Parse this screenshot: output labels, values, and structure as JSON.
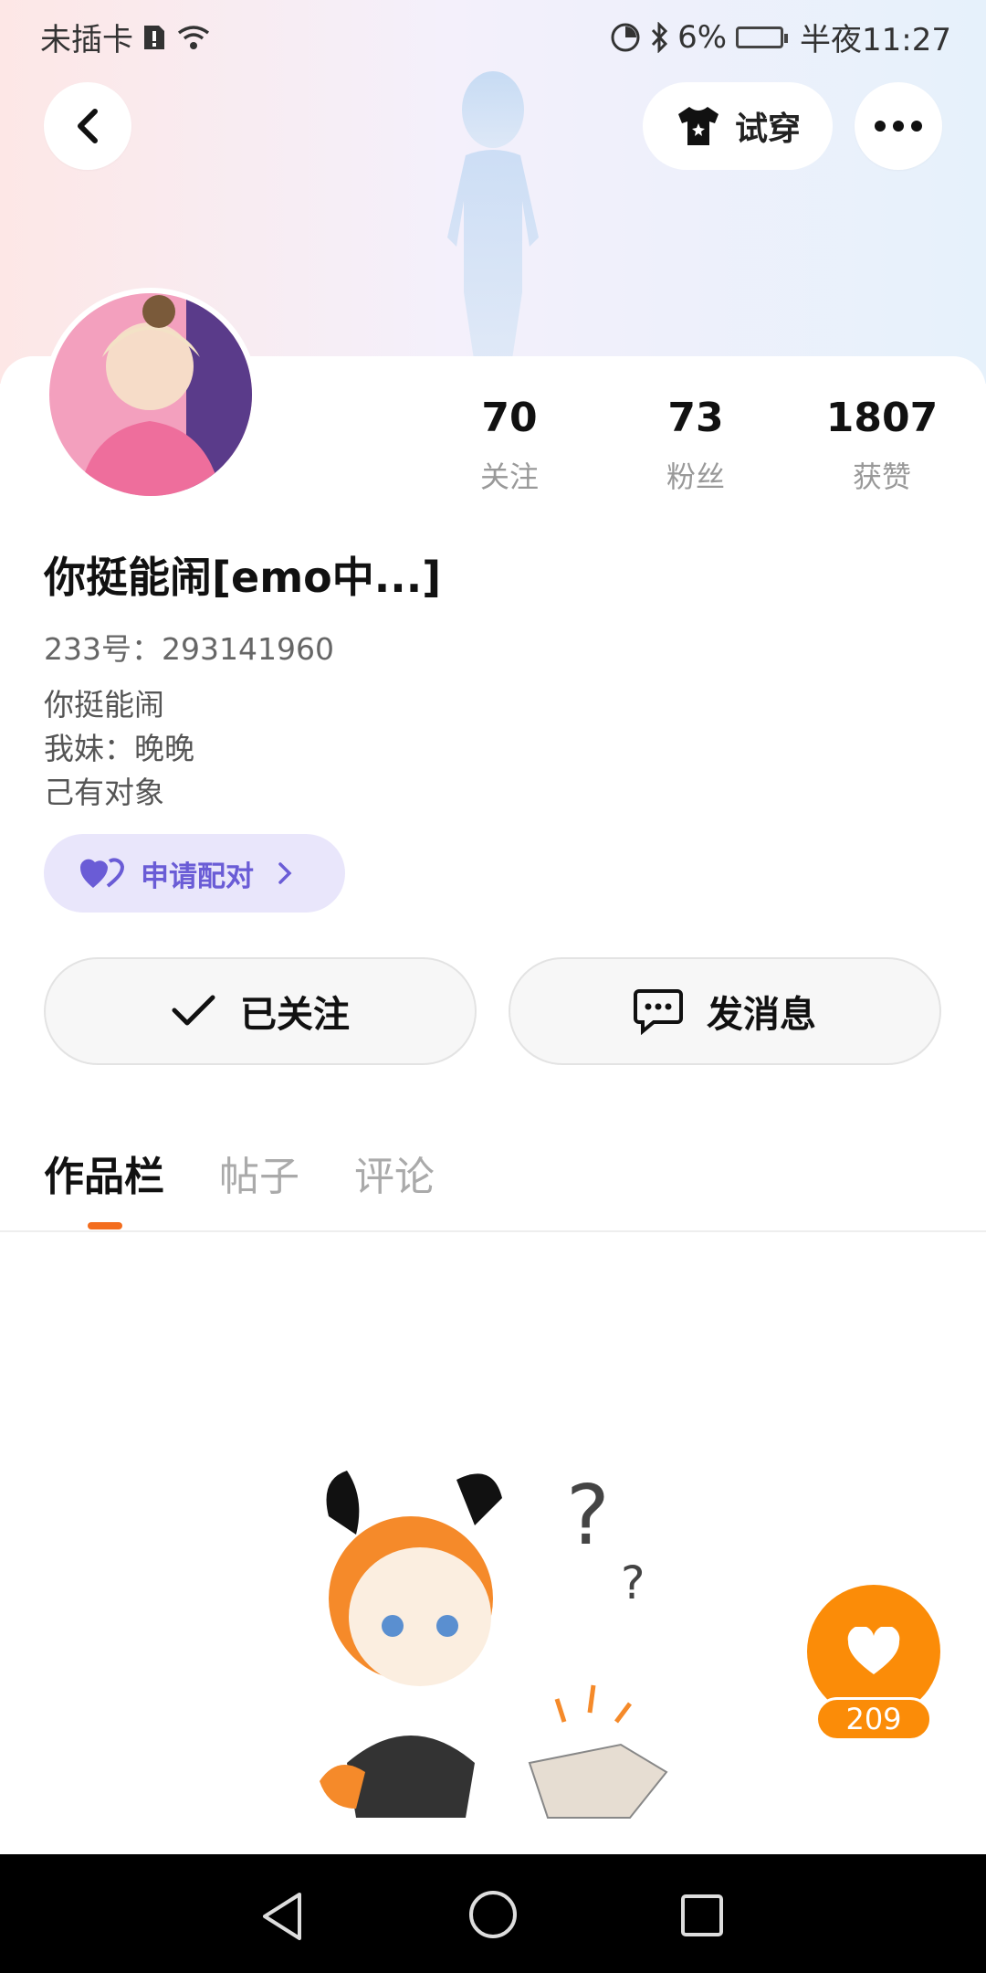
{
  "status_bar": {
    "carrier": "未插卡",
    "battery": "6%",
    "time": "半夜11:27"
  },
  "header": {
    "try_on_label": "试穿"
  },
  "profile": {
    "nickname": "你挺能闹[emo中...]",
    "uid": "233号：293141960",
    "bio_lines": [
      "你挺能闹",
      "我妹：晚晚",
      "己有对象"
    ],
    "stats": [
      {
        "value": "70",
        "label": "关注"
      },
      {
        "value": "73",
        "label": "粉丝"
      },
      {
        "value": "1807",
        "label": "获赞"
      }
    ]
  },
  "pair_button": {
    "label": "申请配对"
  },
  "actions": {
    "follow_label": "已关注",
    "message_label": "发消息"
  },
  "tabs": [
    {
      "label": "作品栏",
      "active": true
    },
    {
      "label": "帖子",
      "active": false
    },
    {
      "label": "评论",
      "active": false
    }
  ],
  "like": {
    "count": "209"
  },
  "colors": {
    "accent_orange": "#fb8c08",
    "pair_purple": "#6a5cd6",
    "tab_indicator": "#f36d1e"
  }
}
